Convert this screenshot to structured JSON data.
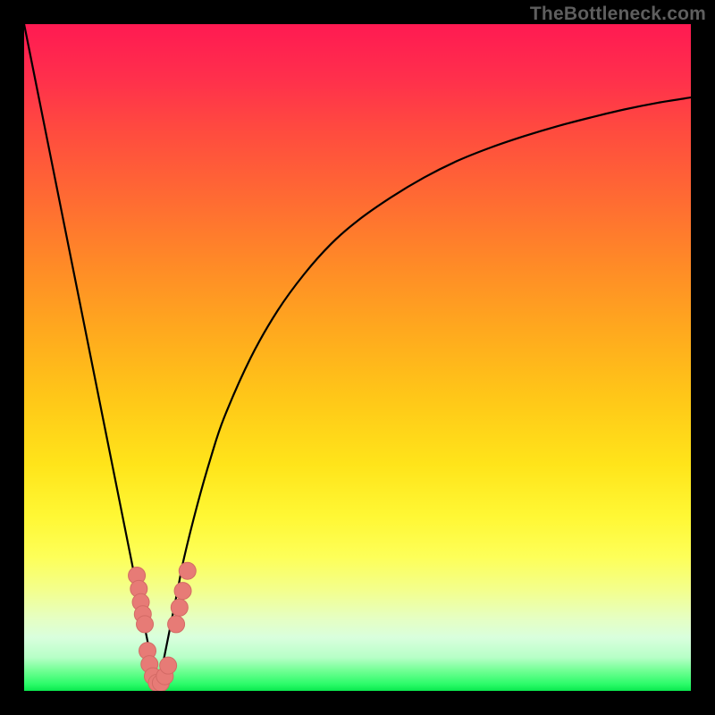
{
  "watermark": "TheBottleneck.com",
  "colors": {
    "frame": "#000000",
    "curve": "#000000",
    "marker_fill": "#e77b76",
    "marker_stroke": "#d36a65"
  },
  "chart_data": {
    "type": "line",
    "title": "",
    "xlabel": "",
    "ylabel": "",
    "xlim": [
      0,
      100
    ],
    "ylim": [
      0,
      100
    ],
    "series": [
      {
        "name": "bottleneck-curve",
        "x": [
          0,
          2,
          4,
          6,
          8,
          10,
          12,
          14,
          16,
          17,
          18,
          19,
          19.5,
          20,
          20.5,
          21,
          22,
          23,
          24,
          26,
          28,
          30,
          34,
          38,
          42,
          46,
          50,
          55,
          60,
          65,
          70,
          75,
          80,
          85,
          90,
          95,
          100
        ],
        "y_percent_from_top": [
          0,
          10,
          20,
          30,
          40,
          50,
          60,
          70,
          80,
          85,
          90,
          95,
          97.5,
          99,
          97.5,
          95,
          90,
          85,
          80,
          72,
          65,
          59,
          50,
          43,
          37.5,
          33,
          29.5,
          26,
          23,
          20.5,
          18.5,
          16.8,
          15.3,
          14,
          12.8,
          11.8,
          11
        ]
      }
    ],
    "markers": [
      {
        "x_pct": 16.9,
        "y_pct_from_top": 82.7
      },
      {
        "x_pct": 17.2,
        "y_pct_from_top": 84.7
      },
      {
        "x_pct": 17.5,
        "y_pct_from_top": 86.7
      },
      {
        "x_pct": 17.8,
        "y_pct_from_top": 88.5
      },
      {
        "x_pct": 18.1,
        "y_pct_from_top": 90.0
      },
      {
        "x_pct": 18.5,
        "y_pct_from_top": 94.0
      },
      {
        "x_pct": 18.8,
        "y_pct_from_top": 96.0
      },
      {
        "x_pct": 19.3,
        "y_pct_from_top": 97.8
      },
      {
        "x_pct": 19.9,
        "y_pct_from_top": 98.8
      },
      {
        "x_pct": 20.5,
        "y_pct_from_top": 98.8
      },
      {
        "x_pct": 21.1,
        "y_pct_from_top": 97.8
      },
      {
        "x_pct": 21.6,
        "y_pct_from_top": 96.2
      },
      {
        "x_pct": 22.8,
        "y_pct_from_top": 90.0
      },
      {
        "x_pct": 23.3,
        "y_pct_from_top": 87.5
      },
      {
        "x_pct": 23.8,
        "y_pct_from_top": 85.0
      },
      {
        "x_pct": 24.5,
        "y_pct_from_top": 82.0
      }
    ]
  }
}
